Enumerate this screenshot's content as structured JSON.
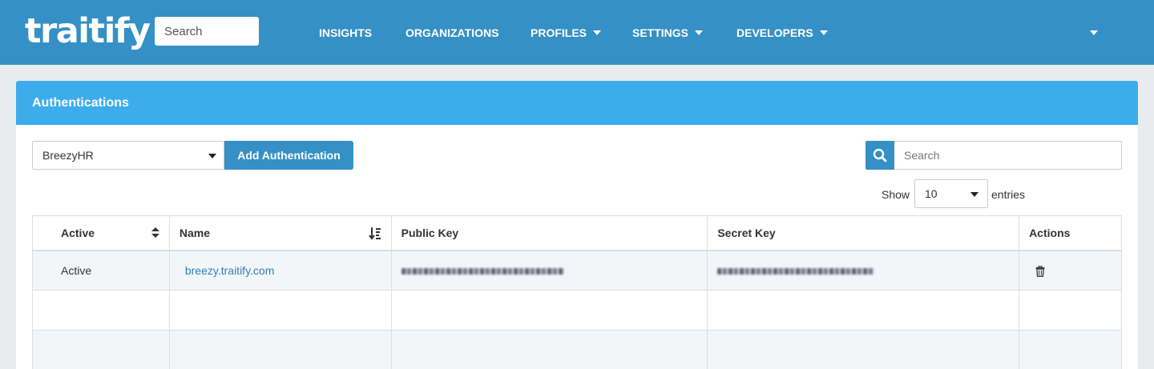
{
  "topbar": {
    "logo": "traitify",
    "search_placeholder": "Search",
    "nav": {
      "insights": "INSIGHTS",
      "organizations": "ORGANIZATIONS",
      "profiles": "PROFILES",
      "settings": "SETTINGS",
      "developers": "DEVELOPERS"
    }
  },
  "panel": {
    "title": "Authentications",
    "provider_selected": "BreezyHR",
    "add_button": "Add Authentication",
    "search_placeholder": "Search",
    "show_label": "Show",
    "show_value": "10",
    "entries_label": "entries"
  },
  "table": {
    "headers": {
      "active": "Active",
      "name": "Name",
      "public_key": "Public Key",
      "secret_key": "Secret Key",
      "actions": "Actions"
    },
    "rows": [
      {
        "active": "Active",
        "name": "breezy.traitify.com",
        "public_key": "(redacted)",
        "secret_key": "(redacted)"
      }
    ]
  },
  "colors": {
    "topbar": "#3590c5",
    "panel_header": "#3daced",
    "button": "#3590c5",
    "link": "#2f7fb7"
  },
  "icons": [
    "search-icon",
    "sort-icon",
    "sort-desc-icon",
    "trash-icon",
    "caret-down-icon"
  ]
}
